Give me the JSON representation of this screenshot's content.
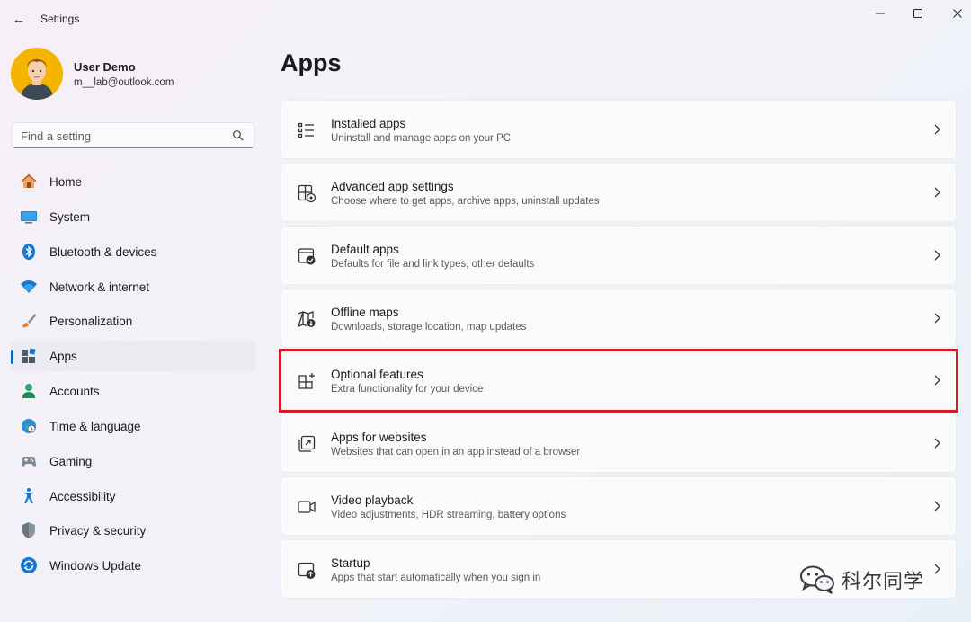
{
  "window": {
    "title": "Settings",
    "back_glyph": "←",
    "controls": [
      "minimize-icon",
      "maximize-icon",
      "close-icon"
    ]
  },
  "profile": {
    "name": "User Demo",
    "email": "m__lab@outlook.com"
  },
  "search": {
    "placeholder": "Find a setting",
    "value": ""
  },
  "sidebar": {
    "items": [
      {
        "label": "Home",
        "icon": "home-icon"
      },
      {
        "label": "System",
        "icon": "system-icon"
      },
      {
        "label": "Bluetooth & devices",
        "icon": "bluetooth-icon"
      },
      {
        "label": "Network & internet",
        "icon": "wifi-icon"
      },
      {
        "label": "Personalization",
        "icon": "brush-icon"
      },
      {
        "label": "Apps",
        "icon": "apps-icon",
        "selected": true
      },
      {
        "label": "Accounts",
        "icon": "accounts-icon"
      },
      {
        "label": "Time & language",
        "icon": "globe-clock-icon"
      },
      {
        "label": "Gaming",
        "icon": "gamepad-icon"
      },
      {
        "label": "Accessibility",
        "icon": "accessibility-icon"
      },
      {
        "label": "Privacy & security",
        "icon": "shield-icon"
      },
      {
        "label": "Windows Update",
        "icon": "update-icon"
      }
    ]
  },
  "main": {
    "title": "Apps",
    "cards": [
      {
        "title": "Installed apps",
        "subtitle": "Uninstall and manage apps on your PC",
        "icon": "list-icon"
      },
      {
        "title": "Advanced app settings",
        "subtitle": "Choose where to get apps, archive apps, uninstall updates",
        "icon": "app-settings-icon"
      },
      {
        "title": "Default apps",
        "subtitle": "Defaults for file and link types, other defaults",
        "icon": "default-apps-icon"
      },
      {
        "title": "Offline maps",
        "subtitle": "Downloads, storage location, map updates",
        "icon": "map-icon"
      },
      {
        "title": "Optional features",
        "subtitle": "Extra functionality for your device",
        "icon": "optional-features-icon",
        "highlighted": true
      },
      {
        "title": "Apps for websites",
        "subtitle": "Websites that can open in an app instead of a browser",
        "icon": "open-external-icon"
      },
      {
        "title": "Video playback",
        "subtitle": "Video adjustments, HDR streaming, battery options",
        "icon": "video-icon"
      },
      {
        "title": "Startup",
        "subtitle": "Apps that start automatically when you sign in",
        "icon": "startup-icon"
      }
    ]
  },
  "watermark": {
    "text": "科尔同学"
  },
  "colors": {
    "accent": "#0067c0",
    "highlight_border": "#d7192a",
    "selected_bg": "#ecebf1"
  }
}
